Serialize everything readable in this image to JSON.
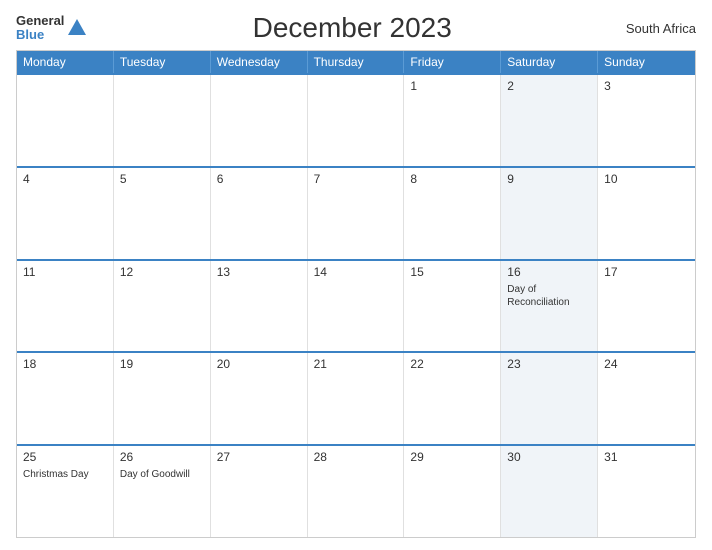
{
  "header": {
    "logo_general": "General",
    "logo_blue": "Blue",
    "title": "December 2023",
    "country": "South Africa"
  },
  "dayHeaders": [
    "Monday",
    "Tuesday",
    "Wednesday",
    "Thursday",
    "Friday",
    "Saturday",
    "Sunday"
  ],
  "weeks": [
    [
      {
        "day": "",
        "event": "",
        "shaded": false
      },
      {
        "day": "",
        "event": "",
        "shaded": false
      },
      {
        "day": "",
        "event": "",
        "shaded": false
      },
      {
        "day": "",
        "event": "",
        "shaded": false
      },
      {
        "day": "1",
        "event": "",
        "shaded": false
      },
      {
        "day": "2",
        "event": "",
        "shaded": true
      },
      {
        "day": "3",
        "event": "",
        "shaded": false
      }
    ],
    [
      {
        "day": "4",
        "event": "",
        "shaded": false
      },
      {
        "day": "5",
        "event": "",
        "shaded": false
      },
      {
        "day": "6",
        "event": "",
        "shaded": false
      },
      {
        "day": "7",
        "event": "",
        "shaded": false
      },
      {
        "day": "8",
        "event": "",
        "shaded": false
      },
      {
        "day": "9",
        "event": "",
        "shaded": true
      },
      {
        "day": "10",
        "event": "",
        "shaded": false
      }
    ],
    [
      {
        "day": "11",
        "event": "",
        "shaded": false
      },
      {
        "day": "12",
        "event": "",
        "shaded": false
      },
      {
        "day": "13",
        "event": "",
        "shaded": false
      },
      {
        "day": "14",
        "event": "",
        "shaded": false
      },
      {
        "day": "15",
        "event": "",
        "shaded": false
      },
      {
        "day": "16",
        "event": "Day of Reconciliation",
        "shaded": true
      },
      {
        "day": "17",
        "event": "",
        "shaded": false
      }
    ],
    [
      {
        "day": "18",
        "event": "",
        "shaded": false
      },
      {
        "day": "19",
        "event": "",
        "shaded": false
      },
      {
        "day": "20",
        "event": "",
        "shaded": false
      },
      {
        "day": "21",
        "event": "",
        "shaded": false
      },
      {
        "day": "22",
        "event": "",
        "shaded": false
      },
      {
        "day": "23",
        "event": "",
        "shaded": true
      },
      {
        "day": "24",
        "event": "",
        "shaded": false
      }
    ],
    [
      {
        "day": "25",
        "event": "Christmas Day",
        "shaded": false
      },
      {
        "day": "26",
        "event": "Day of Goodwill",
        "shaded": false
      },
      {
        "day": "27",
        "event": "",
        "shaded": false
      },
      {
        "day": "28",
        "event": "",
        "shaded": false
      },
      {
        "day": "29",
        "event": "",
        "shaded": false
      },
      {
        "day": "30",
        "event": "",
        "shaded": true
      },
      {
        "day": "31",
        "event": "",
        "shaded": false
      }
    ]
  ]
}
